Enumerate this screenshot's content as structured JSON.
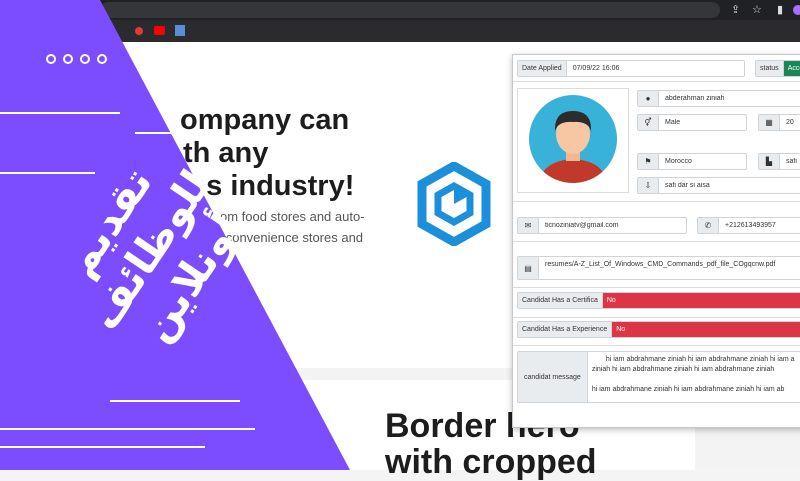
{
  "hero": {
    "line1": "ompany can",
    "line2": "th any",
    "line3": "ss industry!",
    "para1": "om food stores and auto-",
    "para2": "s, convenience stores and",
    "second_heading_1": "Border hero",
    "second_heading_2": "with cropped"
  },
  "banner": {
    "title_line1": "تقديم",
    "title_line2": "للوظائف",
    "title_line3": "أونلاين",
    "color": "#7b4dff"
  },
  "form": {
    "date_label": "Date Applied",
    "date_value": "07/09/22 16:06",
    "status_label": "status",
    "status_value": "Accep",
    "name": "abderahman ziniah",
    "gender": "Male",
    "age": "20",
    "country": "Morocco",
    "city": "safi",
    "address": "safi dar si aisa",
    "email": "ticnoziniatv@gmail.com",
    "phone": "+212613493957",
    "resume": "resumes/A-Z_List_Of_Windows_CMD_Commands_pdf_file_COgqcnw.pdf",
    "cert_label": "Candidat Has a Certifica",
    "cert_value": "No",
    "exp_label": "Candidat Has a Experience",
    "exp_value": "No",
    "message_label": "candidat message",
    "message_line1": "hi iam abdrahmane ziniah hi iam abdrahmane ziniah hi iam a",
    "message_line2": "ziniah hi iam abdrahmane ziniah hi iam abdrahmane ziniah",
    "message_line3": "hi iam abdrahmane ziniah hi iam abdrahmane ziniah hi iam ab"
  },
  "colors": {
    "status_green": "#198754",
    "no_red": "#dc3545",
    "logo_blue": "#1b8fd9"
  }
}
